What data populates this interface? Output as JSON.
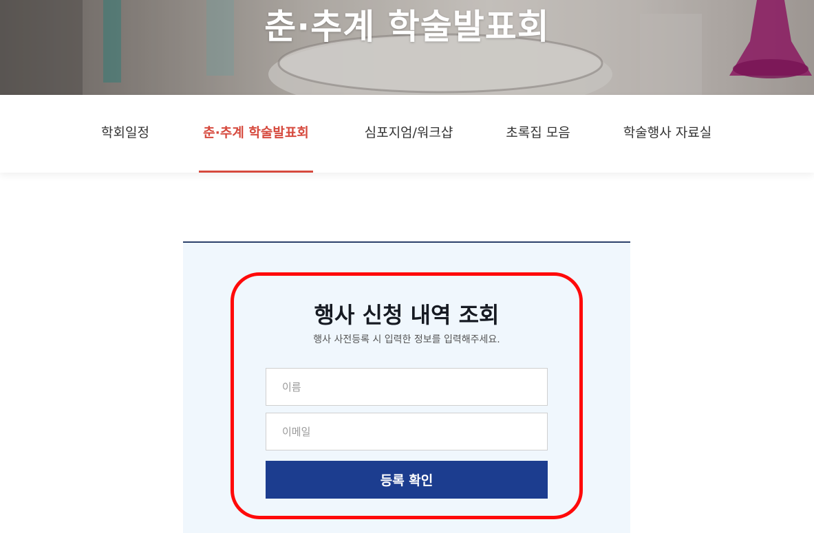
{
  "hero": {
    "title": "춘·추계 학술발표회"
  },
  "subnav": {
    "tabs": [
      {
        "label": "학회일정",
        "active": false
      },
      {
        "label": "춘·추계 학술발표회",
        "active": true
      },
      {
        "label": "심포지엄/워크샵",
        "active": false
      },
      {
        "label": "초록집 모음",
        "active": false
      },
      {
        "label": "학술행사 자료실",
        "active": false
      }
    ],
    "active_color": "#d64a3e"
  },
  "lookup_form": {
    "title": "행사 신청 내역 조회",
    "subtitle": "행사 사전등록 시 입력한 정보를 입력해주세요.",
    "name_placeholder": "이름",
    "email_placeholder": "이메일",
    "submit_label": "등록 확인",
    "button_color": "#1c3d8f",
    "highlight_color": "#ff0a0a"
  }
}
